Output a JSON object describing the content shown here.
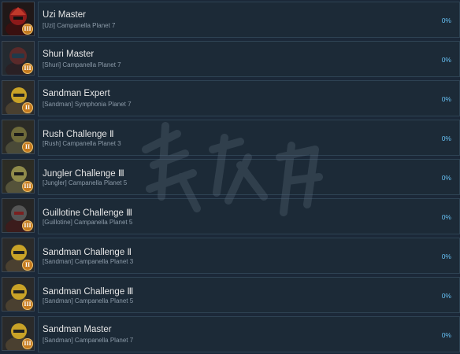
{
  "achievements": [
    {
      "title": "Uzi Master",
      "subtitle": "[Uzi] Campanella Planet 7",
      "percent": "0%",
      "rank": "III",
      "icon": "red-helmet-character-icon",
      "accent": "#8b1a1a"
    },
    {
      "title": "Shuri Master",
      "subtitle": "[Shuri] Campanella Planet 7",
      "percent": "0%",
      "rank": "III",
      "icon": "dark-helmet-character-icon",
      "accent": "#7a2b2b"
    },
    {
      "title": "Sandman Expert",
      "subtitle": "[Sandman] Symphonia Planet 7",
      "percent": "0%",
      "rank": "II",
      "icon": "gold-robot-character-icon",
      "accent": "#c9a227"
    },
    {
      "title": "Rush Challenge Ⅱ",
      "subtitle": "[Rush] Campanella Planet 3",
      "percent": "0%",
      "rank": "II",
      "icon": "olive-armor-character-icon",
      "accent": "#6e6a3a"
    },
    {
      "title": "Jungler Challenge Ⅲ",
      "subtitle": "[Jungler] Campanella Planet 5",
      "percent": "0%",
      "rank": "III",
      "icon": "jungler-character-icon",
      "accent": "#8f8a4a"
    },
    {
      "title": "Guillotine Challenge Ⅲ",
      "subtitle": "[Guillotine] Campanella Planet 5",
      "percent": "0%",
      "rank": "III",
      "icon": "guillotine-character-icon",
      "accent": "#7a2020"
    },
    {
      "title": "Sandman Challenge Ⅱ",
      "subtitle": "[Sandman] Campanella Planet 3",
      "percent": "0%",
      "rank": "II",
      "icon": "gold-robot-character-icon",
      "accent": "#c9a227"
    },
    {
      "title": "Sandman Challenge Ⅲ",
      "subtitle": "[Sandman] Campanella Planet 5",
      "percent": "0%",
      "rank": "III",
      "icon": "gold-robot-character-icon",
      "accent": "#c9a227"
    },
    {
      "title": "Sandman Master",
      "subtitle": "[Sandman] Campanella Planet 7",
      "percent": "0%",
      "rank": "III",
      "icon": "gold-robot-character-icon",
      "accent": "#c9a227"
    }
  ],
  "colors": {
    "background": "#1b2838",
    "panel": "#1c2a37",
    "percent": "#66c0f4",
    "badge": "#c47a1f"
  }
}
